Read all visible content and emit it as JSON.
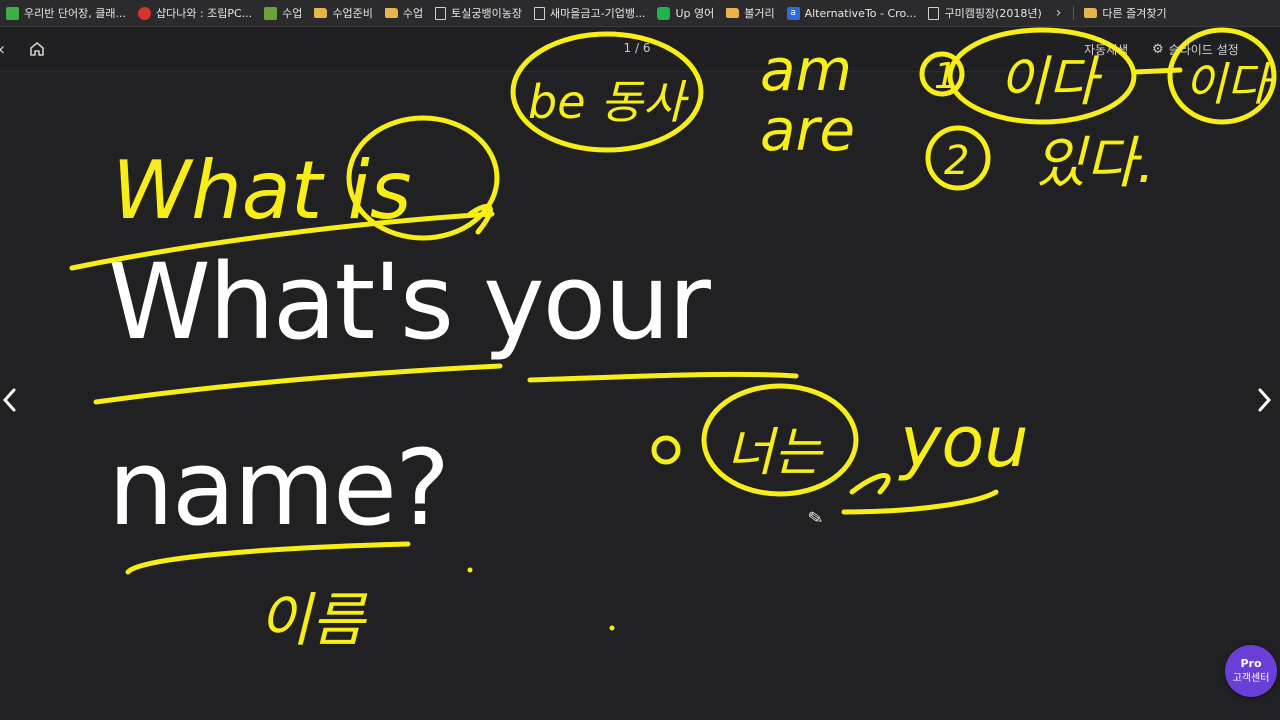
{
  "bookmarks": [
    {
      "label": "우리반 단어장, 클래...",
      "icon": "green-app-icon"
    },
    {
      "label": "샵다나와 : 조립PC...",
      "icon": "danawa-icon"
    },
    {
      "label": "수업",
      "icon": "photo-icon"
    },
    {
      "label": "수업준비",
      "icon": "folder-icon"
    },
    {
      "label": "수업",
      "icon": "folder-icon"
    },
    {
      "label": "토실궁뱅이농장",
      "icon": "page-icon"
    },
    {
      "label": "새마을금고-기업뱅...",
      "icon": "page-icon"
    },
    {
      "label": "Up 영어",
      "icon": "line-icon"
    },
    {
      "label": "볼거리",
      "icon": "folder-icon"
    },
    {
      "label": "AlternativeTo - Cro...",
      "icon": "alternativeto-icon"
    },
    {
      "label": "구미캠핑장(2018년)",
      "icon": "page-icon"
    }
  ],
  "other_bookmarks": {
    "label": "다른 즐겨찾기",
    "icon": "folder-icon"
  },
  "viewer": {
    "page_counter": "1 / 6",
    "autoplay_label": "자동재생",
    "slide_settings_label": "슬라이드 설정"
  },
  "slide": {
    "line1": "What's your",
    "line2": "name?"
  },
  "annotations": {
    "what_is": "What is",
    "be_verb": "be 동사",
    "am": "am",
    "are": "are",
    "num1": "1",
    "ida": "이다",
    "num2": "2",
    "itda": "있다.",
    "ieyo": "이다",
    "neo": "너는",
    "you": "you",
    "ireum": "이름"
  },
  "pro_badge": {
    "title": "Pro",
    "subtitle": "고객센터"
  },
  "colors": {
    "background": "#212124",
    "ink": "#f7ee18",
    "text": "#ffffff",
    "badge": "#6a3fd8"
  }
}
